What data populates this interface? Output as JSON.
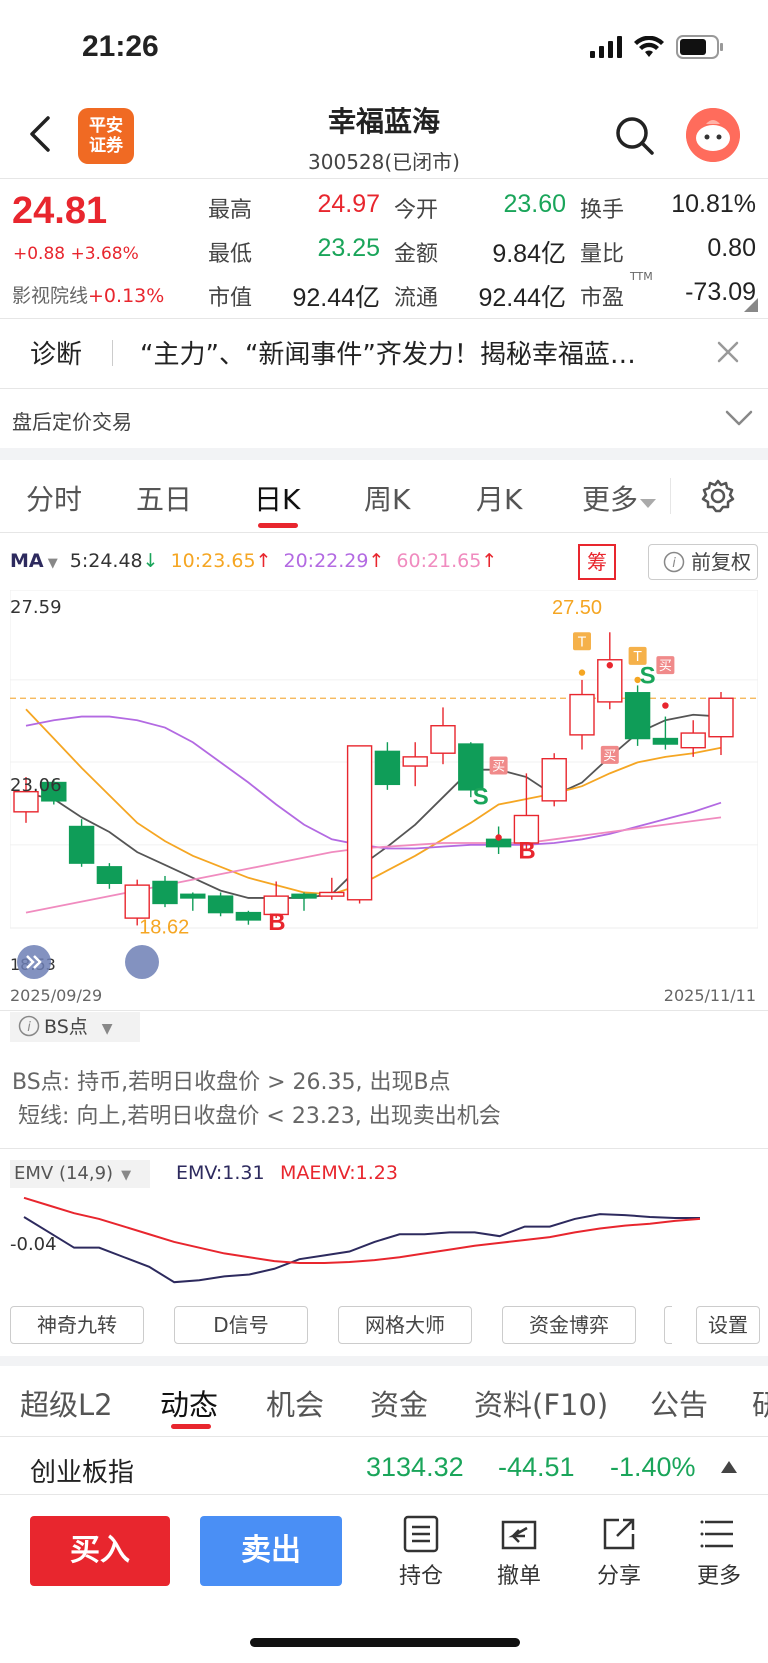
{
  "status_bar": {
    "time": "21:26"
  },
  "header": {
    "title": "幸福蓝海",
    "subtitle": "300528(已闭市)",
    "logo_line1": "平安",
    "logo_line2": "证券"
  },
  "quote": {
    "price": "24.81",
    "change": "+0.88 +3.68%",
    "sector_label": "影视院线",
    "sector_change": "+0.13%",
    "fields": [
      {
        "label": "最高",
        "value": "24.97"
      },
      {
        "label": "今开",
        "value": "23.60"
      },
      {
        "label": "换手",
        "value": "10.81%"
      },
      {
        "label": "最低",
        "value": "23.25"
      },
      {
        "label": "金额",
        "value": "9.84亿"
      },
      {
        "label": "量比",
        "value": "0.80"
      },
      {
        "label": "市值",
        "value": "92.44亿"
      },
      {
        "label": "流通",
        "value": "92.44亿"
      },
      {
        "label": "市盈",
        "value": "-73.09"
      }
    ],
    "pe_superscript": "TTM"
  },
  "diagnosis": {
    "label": "诊断",
    "text": "“主力”、“新闻事件”齐发力！揭秘幸福蓝…"
  },
  "after_hours": "盘后定价交易",
  "kline_tabs": [
    "分时",
    "五日",
    "日K",
    "周K",
    "月K",
    "更多"
  ],
  "ma_legend": {
    "label": "MA",
    "items": [
      {
        "text": "5:24.48",
        "arrow": "↓",
        "color": "#333333"
      },
      {
        "text": "10:23.65",
        "arrow": "↑",
        "color": "#f5a623"
      },
      {
        "text": "20:22.29",
        "arrow": "↑",
        "color": "#b36ae2"
      },
      {
        "text": "60:21.65",
        "arrow": "↑",
        "color": "#f08bbf"
      }
    ],
    "chou": "筹",
    "adjust": "前复权"
  },
  "chart_labels": {
    "high": "27.59",
    "mid": "23.06",
    "low": "18.53",
    "date_start": "2025/09/29",
    "date_end": "2025/11/11",
    "max_marker": "27.50",
    "min_marker": "18.62",
    "b": "B",
    "s": "S",
    "t": "T",
    "buy": "买"
  },
  "chart_data": {
    "type": "candlestick",
    "x_range": [
      "2025/09/29",
      "2025/11/11"
    ],
    "ylim": [
      18.53,
      27.59
    ],
    "candles": [
      {
        "o": 21.7,
        "c": 22.25,
        "h": 22.65,
        "l": 21.4
      },
      {
        "o": 22.5,
        "c": 22.0,
        "h": 22.6,
        "l": 21.9
      },
      {
        "o": 21.3,
        "c": 20.3,
        "h": 21.5,
        "l": 20.2
      },
      {
        "o": 20.2,
        "c": 19.75,
        "h": 20.3,
        "l": 19.6
      },
      {
        "o": 18.8,
        "c": 19.7,
        "h": 19.85,
        "l": 18.6
      },
      {
        "o": 19.8,
        "c": 19.2,
        "h": 19.95,
        "l": 19.1
      },
      {
        "o": 19.45,
        "c": 19.35,
        "h": 19.5,
        "l": 19.0
      },
      {
        "o": 19.4,
        "c": 18.95,
        "h": 19.5,
        "l": 18.85
      },
      {
        "o": 18.95,
        "c": 18.75,
        "h": 19.0,
        "l": 18.62
      },
      {
        "o": 18.9,
        "c": 19.4,
        "h": 19.8,
        "l": 18.8
      },
      {
        "o": 19.45,
        "c": 19.35,
        "h": 19.5,
        "l": 19.0
      },
      {
        "o": 19.4,
        "c": 19.5,
        "h": 19.9,
        "l": 19.3
      },
      {
        "o": 19.3,
        "c": 23.5,
        "h": 23.5,
        "l": 19.2
      },
      {
        "o": 23.35,
        "c": 22.45,
        "h": 23.6,
        "l": 22.3
      },
      {
        "o": 22.95,
        "c": 23.2,
        "h": 23.6,
        "l": 22.4
      },
      {
        "o": 23.3,
        "c": 24.05,
        "h": 24.55,
        "l": 23.0
      },
      {
        "o": 23.55,
        "c": 22.3,
        "h": 23.6,
        "l": 22.1
      },
      {
        "o": 20.95,
        "c": 20.75,
        "h": 21.3,
        "l": 20.55
      },
      {
        "o": 20.85,
        "c": 21.6,
        "h": 22.75,
        "l": 20.65
      },
      {
        "o": 22.0,
        "c": 23.15,
        "h": 23.3,
        "l": 21.85
      },
      {
        "o": 23.8,
        "c": 24.9,
        "h": 25.3,
        "l": 23.4
      },
      {
        "o": 24.7,
        "c": 25.85,
        "h": 26.6,
        "l": 24.5
      },
      {
        "o": 24.95,
        "c": 23.7,
        "h": 25.15,
        "l": 23.5
      },
      {
        "o": 23.7,
        "c": 23.55,
        "h": 24.3,
        "l": 23.4
      },
      {
        "o": 23.45,
        "c": 23.85,
        "h": 24.2,
        "l": 23.2
      },
      {
        "o": 23.75,
        "c": 24.8,
        "h": 24.97,
        "l": 23.25
      }
    ],
    "ma_lines": [
      {
        "name": "MA5",
        "color": "#555555",
        "values": [
          22.2,
          22.05,
          21.55,
          21.15,
          20.6,
          20.25,
          19.9,
          19.55,
          19.35,
          19.35,
          19.35,
          19.45,
          20.2,
          20.75,
          21.35,
          22.1,
          22.85,
          22.85,
          22.65,
          22.15,
          22.5,
          23.2,
          23.85,
          24.2,
          24.35,
          24.3
        ]
      },
      {
        "name": "MA10",
        "color": "#f5a623",
        "values": [
          24.5,
          23.7,
          22.9,
          22.15,
          21.4,
          20.9,
          20.5,
          20.2,
          19.9,
          19.7,
          19.5,
          19.45,
          19.7,
          20.1,
          20.5,
          20.95,
          21.4,
          21.9,
          22.05,
          22.2,
          22.4,
          22.75,
          23.05,
          23.2,
          23.3,
          23.45
        ]
      },
      {
        "name": "MA20",
        "color": "#b36ae2",
        "values": [
          24.05,
          24.2,
          24.3,
          24.3,
          24.2,
          24.0,
          23.6,
          23.05,
          22.5,
          21.9,
          21.35,
          20.95,
          20.8,
          20.7,
          20.7,
          20.75,
          20.8,
          20.8,
          20.8,
          20.85,
          20.95,
          21.1,
          21.3,
          21.5,
          21.7,
          21.95
        ]
      },
      {
        "name": "MA60",
        "color": "#f08bbf",
        "values": [
          18.95,
          19.1,
          19.25,
          19.4,
          19.55,
          19.7,
          19.85,
          20.0,
          20.15,
          20.3,
          20.45,
          20.6,
          20.7,
          20.75,
          20.8,
          20.85,
          20.85,
          20.85,
          20.85,
          20.95,
          21.05,
          21.15,
          21.25,
          21.35,
          21.45,
          21.55
        ]
      }
    ]
  },
  "bs_point": {
    "button": "BS点",
    "line1": "BS点: 持币,若明日收盘价 > 26.35, 出现B点",
    "line2": "短线: 向上,若明日收盘价 < 23.23, 出现卖出机会"
  },
  "emv": {
    "label": "EMV (14,9)",
    "emv_text": "EMV:1.31",
    "maemv_text": "MAEMV:1.23",
    "axis": "-0.04",
    "series": [
      {
        "name": "EMV",
        "color": "#2d2a5e",
        "values": [
          1.0,
          0.2,
          -0.6,
          -0.6,
          -1.1,
          -1.6,
          -2.4,
          -2.3,
          -2.1,
          -2.0,
          -1.7,
          -1.2,
          -1.0,
          -0.8,
          -0.3,
          0.1,
          0.1,
          0.2,
          0.2,
          0.0,
          0.5,
          0.5,
          0.9,
          1.15,
          1.1,
          1.0,
          0.95,
          0.95
        ]
      },
      {
        "name": "MAEMV",
        "color": "#e8262e",
        "values": [
          2.0,
          1.6,
          1.2,
          0.9,
          0.5,
          0.1,
          -0.3,
          -0.6,
          -0.9,
          -1.1,
          -1.3,
          -1.4,
          -1.4,
          -1.35,
          -1.25,
          -1.1,
          -0.9,
          -0.7,
          -0.5,
          -0.35,
          -0.2,
          -0.05,
          0.2,
          0.4,
          0.55,
          0.65,
          0.8,
          0.9
        ]
      }
    ]
  },
  "tool_buttons": [
    "神奇九转",
    "D信号",
    "网格大师",
    "资金博弈",
    "设置"
  ],
  "bottom_tabs": [
    "超级L2",
    "动态",
    "机会",
    "资金",
    "资料(F10)",
    "公告",
    "研"
  ],
  "index": {
    "name": "创业板指",
    "value": "3134.32",
    "change": "-44.51",
    "pct": "-1.40%"
  },
  "actions": {
    "buy": "买入",
    "sell": "卖出",
    "nav": [
      {
        "label": "持仓",
        "icon": "doc-icon"
      },
      {
        "label": "撤单",
        "icon": "undo-icon"
      },
      {
        "label": "分享",
        "icon": "share-icon"
      },
      {
        "label": "更多",
        "icon": "menu-icon"
      }
    ]
  }
}
